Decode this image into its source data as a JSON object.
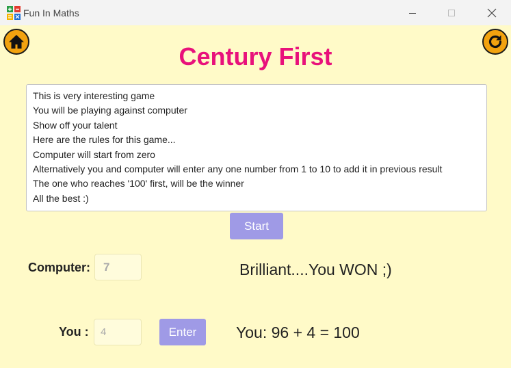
{
  "window": {
    "title": "Fun In Maths"
  },
  "header": {
    "title": "Century First",
    "home_icon": "home-icon",
    "refresh_icon": "refresh-icon"
  },
  "rules": [
    "This is very interesting game",
    "You will be playing against computer",
    "Show off your talent",
    "Here are the rules for this game...",
    "Computer will start from zero",
    "Alternatively you and computer will enter any one number from 1 to 10 to add it in previous result",
    "The one who reaches '100' first, will be the winner",
    "All the best :)"
  ],
  "controls": {
    "start_label": "Start",
    "enter_label": "Enter",
    "computer_label": "Computer:",
    "computer_value": "7",
    "you_label": "You :",
    "you_value": "4"
  },
  "status": {
    "message": "Brilliant....You WON ;)",
    "result": "You: 96 + 4 = 100"
  },
  "colors": {
    "background": "#fffac8",
    "title": "#e8117b",
    "button": "#9f9ae6",
    "icon_button": "#f2a20f"
  }
}
